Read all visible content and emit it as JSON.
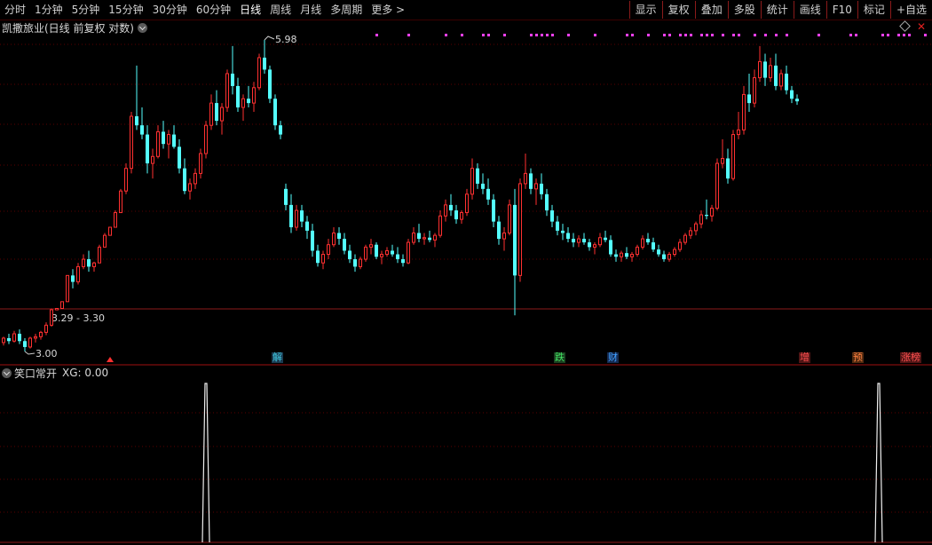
{
  "toolbar": {
    "timeframes": [
      "分时",
      "1分钟",
      "5分钟",
      "15分钟",
      "30分钟",
      "60分钟",
      "日线",
      "周线",
      "月线",
      "多周期",
      "更多 >"
    ],
    "active_timeframe": "日线",
    "buttons": [
      "显示",
      "复权",
      "叠加",
      "多股",
      "统计",
      "画线",
      "F10",
      "标记",
      "+自选"
    ]
  },
  "main_chart": {
    "title": "凯撒旅业(日线 前复权 对数)",
    "high_label": "5.98",
    "low_label": "3.00",
    "range_label": "3.29 - 3.30"
  },
  "events": [
    {
      "label": "解",
      "color": "#40c8e0",
      "bg": "#1a3a50"
    },
    {
      "label": "跌",
      "color": "#40e060",
      "bg": "#1a4020"
    },
    {
      "label": "财",
      "color": "#40a0ff",
      "bg": "#152a50"
    },
    {
      "label": "增",
      "color": "#ff5050",
      "bg": "#501515"
    },
    {
      "label": "预",
      "color": "#ff8040",
      "bg": "#502a10"
    },
    {
      "label": "涨榜",
      "color": "#ff5050",
      "bg": "#501515"
    }
  ],
  "indicator": {
    "name": "笑口常开",
    "value_text": "XG: 0.00"
  },
  "colors": {
    "up": "#ff3030",
    "down": "#54ffff",
    "accent_border": "#8b1a1a",
    "signal_dots": "#ff40ff"
  },
  "chart_data": {
    "type": "candlestick",
    "scale": "log",
    "ylim": [
      3.0,
      5.98
    ],
    "price_high": 5.98,
    "price_low": 3.0,
    "ohlc": [
      [
        3.06,
        3.1,
        3.04,
        3.09
      ],
      [
        3.09,
        3.12,
        3.05,
        3.07
      ],
      [
        3.07,
        3.14,
        3.06,
        3.12
      ],
      [
        3.12,
        3.15,
        3.05,
        3.07
      ],
      [
        3.07,
        3.09,
        3.0,
        3.03
      ],
      [
        3.03,
        3.1,
        3.02,
        3.09
      ],
      [
        3.09,
        3.12,
        3.06,
        3.1
      ],
      [
        3.1,
        3.14,
        3.08,
        3.13
      ],
      [
        3.13,
        3.2,
        3.11,
        3.18
      ],
      [
        3.18,
        3.3,
        3.17,
        3.29
      ],
      [
        3.29,
        3.3,
        3.29,
        3.3
      ],
      [
        3.3,
        3.35,
        3.3,
        3.35
      ],
      [
        3.35,
        3.55,
        3.35,
        3.55
      ],
      [
        3.55,
        3.6,
        3.45,
        3.5
      ],
      [
        3.5,
        3.65,
        3.48,
        3.62
      ],
      [
        3.62,
        3.72,
        3.6,
        3.68
      ],
      [
        3.68,
        3.75,
        3.58,
        3.62
      ],
      [
        3.62,
        3.66,
        3.58,
        3.65
      ],
      [
        3.65,
        3.8,
        3.65,
        3.78
      ],
      [
        3.78,
        3.9,
        3.78,
        3.88
      ],
      [
        3.88,
        3.95,
        3.88,
        3.95
      ],
      [
        3.95,
        4.1,
        3.95,
        4.08
      ],
      [
        4.08,
        4.3,
        4.08,
        4.28
      ],
      [
        4.28,
        4.55,
        4.25,
        4.5
      ],
      [
        4.5,
        5.1,
        4.45,
        5.05
      ],
      [
        5.05,
        5.65,
        4.9,
        4.95
      ],
      [
        4.95,
        5.15,
        4.8,
        4.85
      ],
      [
        4.85,
        4.95,
        4.45,
        4.55
      ],
      [
        4.55,
        4.7,
        4.4,
        4.62
      ],
      [
        4.62,
        4.95,
        4.6,
        4.88
      ],
      [
        4.88,
        5.0,
        4.7,
        4.75
      ],
      [
        4.75,
        4.9,
        4.6,
        4.85
      ],
      [
        4.85,
        4.95,
        4.7,
        4.72
      ],
      [
        4.72,
        4.8,
        4.45,
        4.5
      ],
      [
        4.5,
        4.6,
        4.25,
        4.28
      ],
      [
        4.28,
        4.4,
        4.2,
        4.35
      ],
      [
        4.35,
        4.5,
        4.3,
        4.45
      ],
      [
        4.45,
        4.7,
        4.4,
        4.65
      ],
      [
        4.65,
        5.0,
        4.6,
        4.95
      ],
      [
        4.95,
        5.3,
        4.9,
        5.2
      ],
      [
        5.2,
        5.35,
        4.95,
        5.0
      ],
      [
        5.0,
        5.2,
        4.85,
        5.15
      ],
      [
        5.15,
        5.6,
        5.1,
        5.55
      ],
      [
        5.55,
        5.9,
        5.3,
        5.4
      ],
      [
        5.4,
        5.5,
        5.1,
        5.15
      ],
      [
        5.15,
        5.3,
        5.0,
        5.25
      ],
      [
        5.25,
        5.4,
        5.15,
        5.2
      ],
      [
        5.2,
        5.45,
        5.1,
        5.38
      ],
      [
        5.38,
        5.8,
        5.35,
        5.75
      ],
      [
        5.75,
        5.98,
        5.55,
        5.6
      ],
      [
        5.6,
        5.65,
        5.2,
        5.25
      ],
      [
        5.25,
        5.3,
        4.9,
        4.95
      ],
      [
        4.95,
        5.0,
        4.8,
        4.85
      ],
      [
        4.3,
        4.35,
        4.1,
        4.15
      ],
      [
        4.15,
        4.25,
        3.9,
        3.95
      ],
      [
        3.95,
        4.15,
        3.92,
        4.1
      ],
      [
        4.1,
        4.15,
        3.95,
        4.0
      ],
      [
        4.0,
        4.05,
        3.85,
        3.92
      ],
      [
        3.92,
        3.98,
        3.7,
        3.75
      ],
      [
        3.75,
        3.8,
        3.62,
        3.65
      ],
      [
        3.65,
        3.75,
        3.6,
        3.72
      ],
      [
        3.72,
        3.85,
        3.68,
        3.8
      ],
      [
        3.8,
        3.95,
        3.78,
        3.9
      ],
      [
        3.9,
        3.95,
        3.8,
        3.85
      ],
      [
        3.85,
        3.9,
        3.72,
        3.75
      ],
      [
        3.75,
        3.8,
        3.65,
        3.68
      ],
      [
        3.68,
        3.72,
        3.58,
        3.62
      ],
      [
        3.62,
        3.7,
        3.6,
        3.68
      ],
      [
        3.68,
        3.8,
        3.66,
        3.78
      ],
      [
        3.78,
        3.85,
        3.72,
        3.8
      ],
      [
        3.8,
        3.82,
        3.68,
        3.7
      ],
      [
        3.7,
        3.75,
        3.64,
        3.72
      ],
      [
        3.72,
        3.78,
        3.7,
        3.75
      ],
      [
        3.75,
        3.8,
        3.7,
        3.72
      ],
      [
        3.72,
        3.78,
        3.65,
        3.68
      ],
      [
        3.68,
        3.72,
        3.62,
        3.65
      ],
      [
        3.65,
        3.85,
        3.64,
        3.82
      ],
      [
        3.82,
        3.95,
        3.8,
        3.9
      ],
      [
        3.9,
        3.98,
        3.82,
        3.85
      ],
      [
        3.85,
        3.9,
        3.8,
        3.86
      ],
      [
        3.86,
        3.92,
        3.82,
        3.84
      ],
      [
        3.84,
        3.9,
        3.78,
        3.88
      ],
      [
        3.88,
        4.1,
        3.86,
        4.05
      ],
      [
        4.05,
        4.2,
        4.0,
        4.15
      ],
      [
        4.15,
        4.25,
        4.05,
        4.1
      ],
      [
        4.1,
        4.15,
        3.98,
        4.02
      ],
      [
        4.02,
        4.1,
        3.98,
        4.08
      ],
      [
        4.08,
        4.3,
        4.05,
        4.25
      ],
      [
        4.25,
        4.6,
        4.2,
        4.5
      ],
      [
        4.5,
        4.55,
        4.3,
        4.35
      ],
      [
        4.35,
        4.45,
        4.25,
        4.3
      ],
      [
        4.3,
        4.4,
        4.15,
        4.2
      ],
      [
        4.2,
        4.25,
        3.95,
        4.0
      ],
      [
        4.0,
        4.05,
        3.8,
        3.85
      ],
      [
        3.85,
        3.95,
        3.75,
        3.9
      ],
      [
        3.9,
        4.2,
        3.88,
        4.15
      ],
      [
        4.15,
        4.3,
        3.25,
        3.55
      ],
      [
        3.55,
        4.4,
        3.5,
        4.35
      ],
      [
        4.35,
        4.65,
        4.3,
        4.45
      ],
      [
        4.45,
        4.5,
        4.25,
        4.3
      ],
      [
        4.3,
        4.4,
        4.15,
        4.35
      ],
      [
        4.35,
        4.45,
        4.2,
        4.25
      ],
      [
        4.25,
        4.3,
        4.05,
        4.1
      ],
      [
        4.1,
        4.15,
        3.95,
        4.0
      ],
      [
        4.0,
        4.05,
        3.88,
        3.92
      ],
      [
        3.92,
        3.98,
        3.84,
        3.9
      ],
      [
        3.9,
        3.95,
        3.82,
        3.85
      ],
      [
        3.85,
        3.9,
        3.78,
        3.82
      ],
      [
        3.82,
        3.88,
        3.78,
        3.85
      ],
      [
        3.85,
        3.9,
        3.8,
        3.82
      ],
      [
        3.82,
        3.85,
        3.75,
        3.78
      ],
      [
        3.78,
        3.82,
        3.72,
        3.8
      ],
      [
        3.8,
        3.9,
        3.78,
        3.86
      ],
      [
        3.86,
        3.92,
        3.82,
        3.84
      ],
      [
        3.84,
        3.88,
        3.7,
        3.72
      ],
      [
        3.72,
        3.76,
        3.66,
        3.7
      ],
      [
        3.7,
        3.75,
        3.66,
        3.73
      ],
      [
        3.73,
        3.78,
        3.68,
        3.7
      ],
      [
        3.7,
        3.74,
        3.66,
        3.72
      ],
      [
        3.72,
        3.8,
        3.7,
        3.78
      ],
      [
        3.78,
        3.88,
        3.76,
        3.85
      ],
      [
        3.85,
        3.9,
        3.8,
        3.82
      ],
      [
        3.82,
        3.86,
        3.74,
        3.76
      ],
      [
        3.76,
        3.8,
        3.7,
        3.72
      ],
      [
        3.72,
        3.75,
        3.66,
        3.68
      ],
      [
        3.68,
        3.74,
        3.66,
        3.72
      ],
      [
        3.72,
        3.78,
        3.7,
        3.76
      ],
      [
        3.76,
        3.85,
        3.74,
        3.82
      ],
      [
        3.82,
        3.9,
        3.8,
        3.88
      ],
      [
        3.88,
        3.95,
        3.85,
        3.92
      ],
      [
        3.92,
        4.0,
        3.88,
        3.98
      ],
      [
        3.98,
        4.1,
        3.94,
        4.06
      ],
      [
        4.06,
        4.2,
        4.02,
        4.05
      ],
      [
        4.05,
        4.15,
        4.0,
        4.12
      ],
      [
        4.12,
        4.6,
        4.1,
        4.55
      ],
      [
        4.55,
        4.8,
        4.5,
        4.6
      ],
      [
        4.6,
        4.7,
        4.35,
        4.4
      ],
      [
        4.4,
        4.9,
        4.38,
        4.85
      ],
      [
        4.85,
        5.1,
        4.8,
        4.9
      ],
      [
        4.9,
        5.4,
        4.85,
        5.3
      ],
      [
        5.3,
        5.55,
        5.1,
        5.2
      ],
      [
        5.2,
        5.6,
        5.15,
        5.5
      ],
      [
        5.5,
        5.9,
        5.45,
        5.7
      ],
      [
        5.7,
        5.8,
        5.4,
        5.5
      ],
      [
        5.5,
        5.75,
        5.45,
        5.65
      ],
      [
        5.65,
        5.8,
        5.35,
        5.4
      ],
      [
        5.4,
        5.6,
        5.35,
        5.55
      ],
      [
        5.55,
        5.65,
        5.3,
        5.35
      ],
      [
        5.35,
        5.4,
        5.2,
        5.25
      ],
      [
        5.25,
        5.3,
        5.18,
        5.22
      ]
    ],
    "event_markers": [
      {
        "label": "解",
        "index": 51
      },
      {
        "label": "跌",
        "index": 104
      },
      {
        "label": "财",
        "index": 114
      },
      {
        "label": "增",
        "index": 150
      },
      {
        "label": "预",
        "index": 160
      },
      {
        "label": "涨榜",
        "index": 169
      }
    ],
    "signal_dot_indices": [
      70,
      76,
      83,
      86,
      90,
      91,
      94,
      99,
      100,
      101,
      102,
      103,
      106,
      111,
      117,
      118,
      121,
      124,
      125,
      127,
      128,
      129,
      131,
      132,
      133,
      135,
      137,
      138,
      141,
      143,
      145,
      147,
      153,
      159,
      160,
      165,
      166,
      168,
      169,
      170,
      173
    ],
    "indicator_series": {
      "name": "XG",
      "signal_indices": [
        38,
        168
      ],
      "values": [
        0,
        1
      ],
      "last_value": 0.0
    }
  }
}
